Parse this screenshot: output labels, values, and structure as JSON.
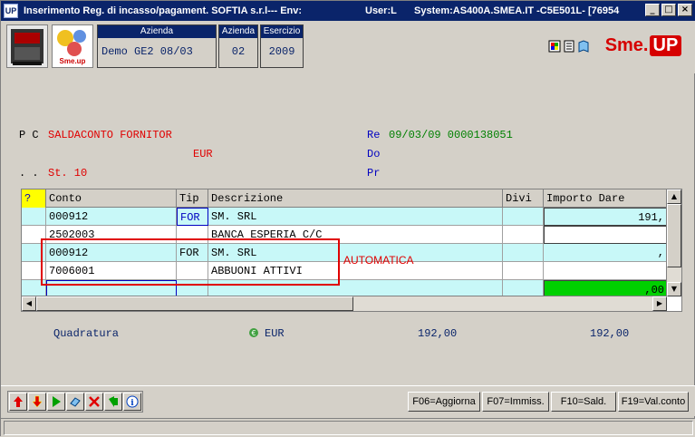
{
  "window": {
    "app_icon": "UP",
    "title": "Inserimento Reg. di incasso/pagament.  SOFTIA s.r.l--- Env:",
    "title_user": "User:L",
    "title_system": "System:AS400A.SMEA.IT -C5E501L- [76954",
    "buttons": [
      "_",
      "□",
      "×"
    ]
  },
  "header": {
    "azienda_caption": "Azienda",
    "azienda_value": "Demo GE2 08/03",
    "azienda2_caption": "Azienda",
    "azienda2_value": "02",
    "esercizio_caption": "Esercizio",
    "esercizio_value": "2009",
    "brand": {
      "sme": "Sme.",
      "up": "UP"
    },
    "logo_text": "Sme.up",
    "toolbar_icons": [
      "color-palette-icon",
      "document-icon",
      "book-icon"
    ]
  },
  "form": {
    "pc_label": "P C",
    "pc_value": "SALDACONTO FORNITOR",
    "currency": "EUR",
    "dots_label": ". .",
    "st_value": "St. 10",
    "re_label": "Re",
    "re_value": "09/03/09 0000138051",
    "do_label": "Do",
    "pr_label": "Pr"
  },
  "grid": {
    "headers": [
      "?",
      "Conto",
      "Tip",
      "Descrizione",
      "Divi",
      "Importo Dare"
    ],
    "rows": [
      {
        "conto": "000912",
        "tip": "FOR",
        "descrizione": "SM.   SRL",
        "divi": "",
        "importo": "191,"
      },
      {
        "conto": "2502003",
        "tip": "",
        "descrizione": "BANCA ESPERIA C/C",
        "divi": "",
        "importo": ""
      },
      {
        "conto": "000912",
        "tip": "FOR",
        "descrizione": "SM.   SRL",
        "divi": "",
        "importo": ","
      },
      {
        "conto": "7006001",
        "tip": "",
        "descrizione": "ABBUONI ATTIVI",
        "divi": "",
        "importo": ""
      },
      {
        "conto": "",
        "tip": "",
        "descrizione": "",
        "divi": "",
        "importo": ",00"
      }
    ],
    "annotation": "AUTOMATICA"
  },
  "totals": {
    "label": "Quadratura",
    "currency": "EUR",
    "dare": "192,00",
    "avere": "192,00"
  },
  "function_keys": [
    "F06=Aggiorna",
    "F07=Immiss.",
    "F10=Sald.",
    "F19=Val.conto"
  ],
  "nav_icons": [
    "arrow-up-icon",
    "arrow-down-icon",
    "play-icon",
    "eraser-icon",
    "delete-icon",
    "back-icon",
    "info-icon"
  ],
  "colors": {
    "title_bar": "#0a246a",
    "red_text": "#e00000",
    "green_text": "#008000",
    "blue_text": "#0000c0",
    "row_cyan": "#c8f8f8",
    "green_cell": "#00d000"
  }
}
